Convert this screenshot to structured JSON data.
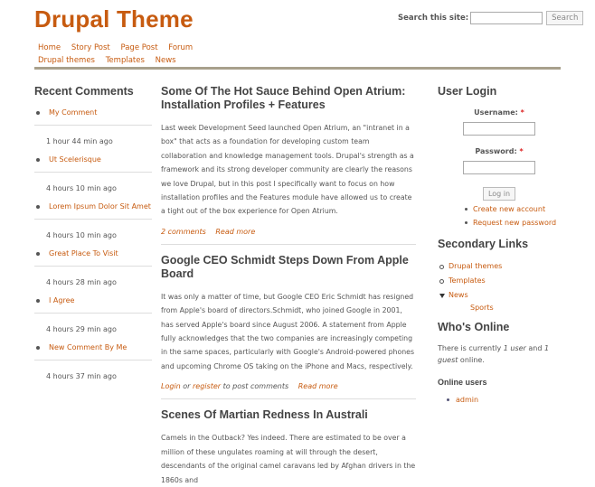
{
  "site": {
    "title": "Drupal Theme"
  },
  "search": {
    "label": "Search this site:",
    "value": "",
    "button": "Search"
  },
  "primary_nav": [
    "Home",
    "Story Post",
    "Page Post",
    "Forum"
  ],
  "secondary_nav": [
    "Drupal themes",
    "Templates",
    "News"
  ],
  "recent_comments": {
    "title": "Recent Comments",
    "items": [
      {
        "title": "My Comment",
        "time": "1 hour 44 min ago"
      },
      {
        "title": "Ut Scelerisque",
        "time": "4 hours 10 min ago"
      },
      {
        "title": "Lorem Ipsum Dolor Sit Amet",
        "time": "4 hours 10 min ago"
      },
      {
        "title": "Great Place To Visit",
        "time": "4 hours 28 min ago"
      },
      {
        "title": "I Agree",
        "time": "4 hours 29 min ago"
      },
      {
        "title": "New Comment By Me",
        "time": "4 hours 37 min ago"
      }
    ]
  },
  "nodes": [
    {
      "title": "Some Of The Hot Sauce Behind Open Atrium: Installation Profiles + Features",
      "body": "Last week Development Seed launched Open Atrium, an \"intranet in a box\" that acts as a foundation for developing custom team collaboration and knowledge management tools. Drupal's strength as a framework and its strong developer community are clearly the reasons we love Drupal, but in this post I specifically want to focus on how installation profiles and the Features module have allowed us to create a tight out of the box experience for Open Atrium.",
      "links": {
        "comments": "2 comments",
        "read_more": "Read more"
      }
    },
    {
      "title": "Google CEO Schmidt Steps Down From Apple Board",
      "body": "It was only a matter of time, but Google CEO Eric Schmidt has resigned from Apple's board of directors.Schmidt, who joined Google in 2001, has served Apple's board since August 2006. A statement from Apple fully acknowledges that the two companies are increasingly competing in the same spaces, particularly with Google's Android-powered phones and upcoming Chrome OS taking on the iPhone and Macs, respectively.",
      "links": {
        "login": "Login",
        "or": "or",
        "register": "register",
        "post_text": "to post comments",
        "read_more": "Read more"
      }
    },
    {
      "title": "Scenes Of Martian Redness In Australi",
      "body": "Camels in the Outback? Yes indeed. There are estimated to be over a million of these ungulates roaming at will through the desert, descendants of the original camel caravans led by Afghan drivers in the 1860s and"
    }
  ],
  "user_login": {
    "title": "User Login",
    "username_label": "Username:",
    "password_label": "Password:",
    "required_mark": "*",
    "button": "Log in",
    "links": [
      "Create new account",
      "Request new password"
    ]
  },
  "secondary_links": {
    "title": "Secondary Links",
    "items": [
      "Drupal themes",
      "Templates",
      "News"
    ],
    "sub_items": [
      "Sports"
    ]
  },
  "whos_online": {
    "title": "Who's Online",
    "text_1": "There is currently",
    "users": "1 user",
    "and": "and",
    "guests": "1 guest",
    "text_2": "online.",
    "subtitle": "Online users",
    "online_users": [
      "admin"
    ]
  }
}
